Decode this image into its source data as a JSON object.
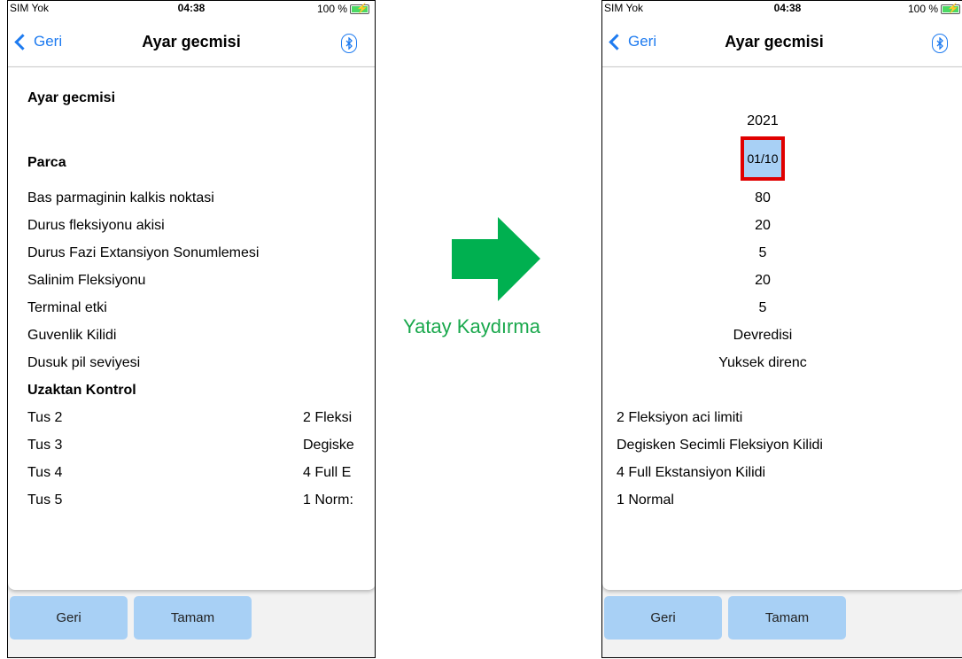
{
  "status_bar": {
    "carrier": "SIM Yok",
    "time": "04:38",
    "battery": "100 %"
  },
  "nav": {
    "back_label": "Geri",
    "title": "Ayar gecmisi"
  },
  "left_list": {
    "heading": "Ayar gecmisi",
    "section_part": "Parca",
    "items": [
      "Bas parmaginin kalkis noktasi",
      "Durus  fleksiyonu akisi",
      "Durus Fazi Extansiyon Sonumlemesi",
      "Salinim Fleksiyonu",
      "Terminal etki",
      "Guvenlik Kilidi",
      "Dusuk pil seviyesi"
    ],
    "section_remote": "Uzaktan Kontrol",
    "remote_rows": [
      {
        "label": "Tus 2",
        "value": "2 Fleksi"
      },
      {
        "label": "Tus 3",
        "value": "Degiske"
      },
      {
        "label": "Tus 4",
        "value": "4 Full E"
      },
      {
        "label": "Tus 5",
        "value": "1 Norm:"
      }
    ]
  },
  "right_list": {
    "year": "2021",
    "date_selected": "01/10",
    "values": [
      "80",
      "20",
      "5",
      "20",
      "5",
      "Devredisi",
      "Yuksek direnc"
    ],
    "remote_values": [
      "2 Fleksiyon aci limiti",
      "Degisken Secimli Fleksiyon Kilidi",
      "4 Full Ekstansiyon Kilidi",
      "1 Normal"
    ]
  },
  "buttons": {
    "back": "Geri",
    "ok": "Tamam"
  },
  "caption": "Yatay Kaydırma",
  "colors": {
    "accent": "#1e7bf0",
    "button": "#a8d0f5",
    "arrow": "#00b050",
    "highlight_border": "#e00000"
  },
  "icons": {
    "back": "chevron-left-icon",
    "bluetooth": "bluetooth-icon",
    "battery": "battery-charging-icon",
    "arrow": "arrow-right-icon"
  }
}
